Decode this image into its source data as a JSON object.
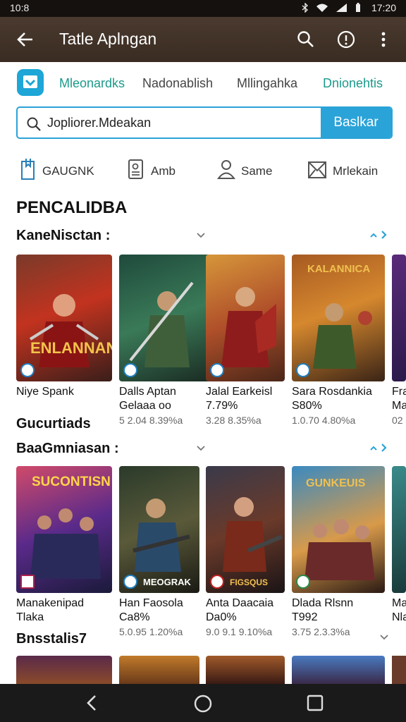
{
  "status": {
    "left_time": "10:8",
    "right_time": "17:20"
  },
  "appbar": {
    "title": "Tatle Aplngan"
  },
  "tabs": [
    "Mleonardks",
    "Nadonablish",
    "Mllingahka",
    "Dnionehtis"
  ],
  "search": {
    "value": "Jopliorer.Mdeakan",
    "button": "Baslkar"
  },
  "categories": [
    "GAUGNK",
    "Amb",
    "Same",
    "Mrlekain"
  ],
  "heading": "PENCALIDBA",
  "section1": {
    "title": "KaneNisctan :",
    "cards": [
      {
        "name": "Niye Spank",
        "sub": "",
        "meta": "",
        "caption": "ENLANNAN"
      },
      {
        "name": "Dalls Aptan",
        "sub": "Gelaaa oo",
        "meta": "5 2.04 8.39%a",
        "caption": ""
      },
      {
        "name": "Jalal Earkeisl",
        "sub": "7.79%",
        "meta": "3.28 8.35%a",
        "caption": ""
      },
      {
        "name": "Sara Rosdankia",
        "sub": "S80%",
        "meta": "1.0.70 4.80%a",
        "caption": "KALANNICA"
      },
      {
        "name": "Fra",
        "sub": "Ma",
        "meta": "02",
        "caption": ""
      }
    ]
  },
  "subhead": "Gucurtiads",
  "section2": {
    "title": "BaaGmniasan :",
    "cards": [
      {
        "name": "Manakenipad",
        "sub": "Tlaka",
        "meta": "",
        "caption": "SUCONTISN"
      },
      {
        "name": "Han Faosola",
        "sub": "Ca8%",
        "meta": "5.0.95 1.20%a",
        "caption": "MEOGRAK"
      },
      {
        "name": "Anta Daacaia",
        "sub": "Da0%",
        "meta": "9.0 9.1 9.10%a",
        "caption": "FIGSQUS"
      },
      {
        "name": "Dlada Rlsnn",
        "sub": "T992",
        "meta": "3.75 2.3.3%a",
        "caption": "GUNKEUIS"
      },
      {
        "name": "Ma",
        "sub": "Nla",
        "meta": "",
        "caption": ""
      }
    ]
  },
  "section3": {
    "title": "Bnsstalis7"
  },
  "colors": {
    "accent": "#2aa3d8",
    "appbar": "#3f3127",
    "navbar": "#1a1a1a"
  }
}
